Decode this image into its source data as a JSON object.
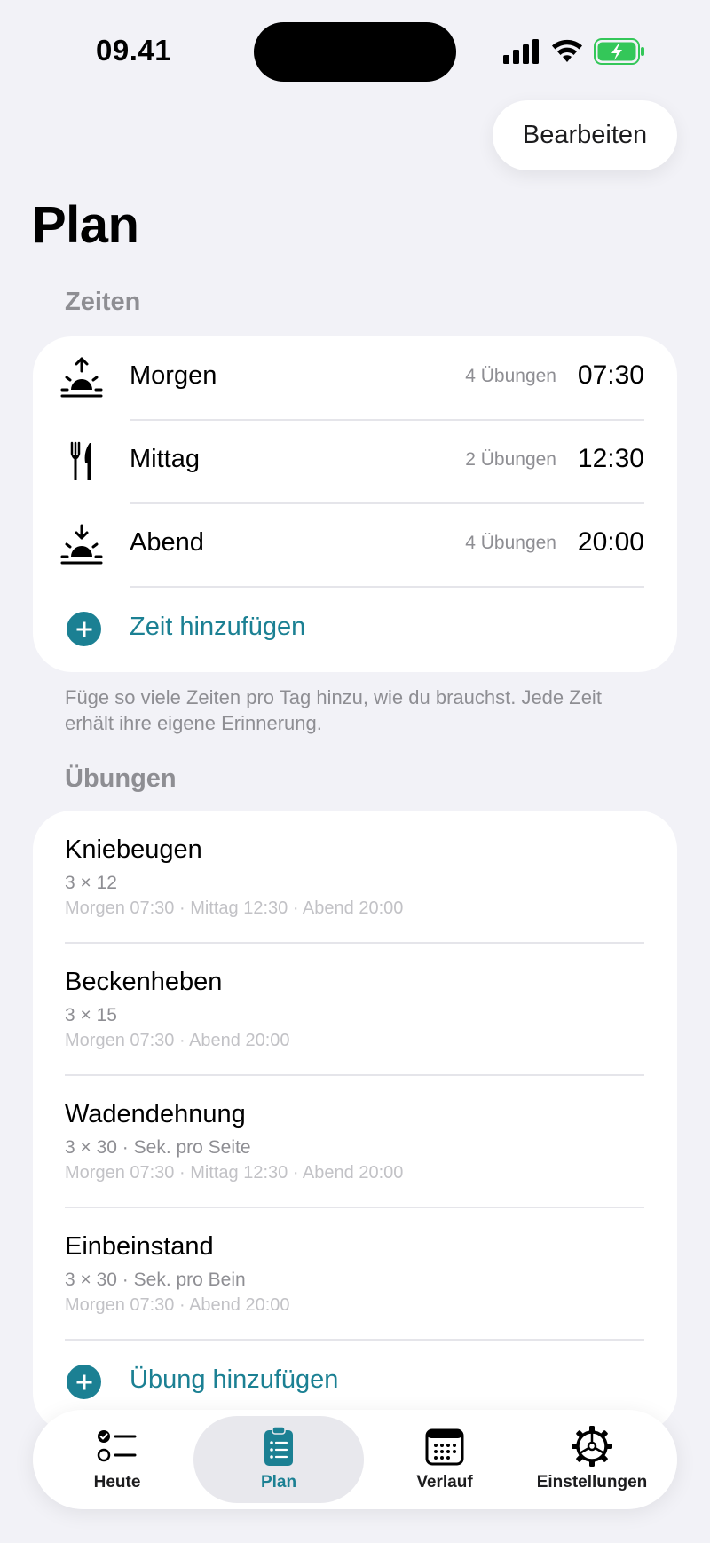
{
  "status_bar": {
    "time": "09.41"
  },
  "header": {
    "edit_label": "Bearbeiten",
    "title": "Plan"
  },
  "times_section": {
    "header": "Zeiten",
    "items": [
      {
        "icon": "sunrise-icon",
        "name": "Morgen",
        "count": "4 Übungen",
        "time": "07:30"
      },
      {
        "icon": "fork-knife-icon",
        "name": "Mittag",
        "count": "2 Übungen",
        "time": "12:30"
      },
      {
        "icon": "sunset-icon",
        "name": "Abend",
        "count": "4 Übungen",
        "time": "20:00"
      }
    ],
    "add_label": "Zeit hinzufügen",
    "footnote": "Füge so viele Zeiten pro Tag hinzu, wie du brauchst. Jede Zeit erhält ihre eigene Erinnerung."
  },
  "exercises_section": {
    "header": "Übungen",
    "items": [
      {
        "name": "Kniebeugen",
        "detail": "3 × 12",
        "times": "Morgen 07:30 · Mittag 12:30 · Abend 20:00"
      },
      {
        "name": "Beckenheben",
        "detail": "3 × 15",
        "times": "Morgen 07:30 · Abend 20:00"
      },
      {
        "name": "Wadendehnung",
        "detail": "3 × 30 · Sek. pro Seite",
        "times": "Morgen 07:30 · Mittag 12:30 · Abend 20:00"
      },
      {
        "name": "Einbeinstand",
        "detail": "3 × 30 · Sek. pro Bein",
        "times": "Morgen 07:30 · Abend 20:00"
      }
    ],
    "add_label": "Übung hinzufügen"
  },
  "tab_bar": {
    "tabs": [
      {
        "label": "Heute",
        "icon": "checklist-icon"
      },
      {
        "label": "Plan",
        "icon": "clipboard-list-icon",
        "active": true
      },
      {
        "label": "Verlauf",
        "icon": "calendar-icon"
      },
      {
        "label": "Einstellungen",
        "icon": "gear-icon"
      }
    ]
  },
  "colors": {
    "accent": "#1B8093",
    "background": "#F2F2F7",
    "secondary_text": "#8E8E93"
  }
}
